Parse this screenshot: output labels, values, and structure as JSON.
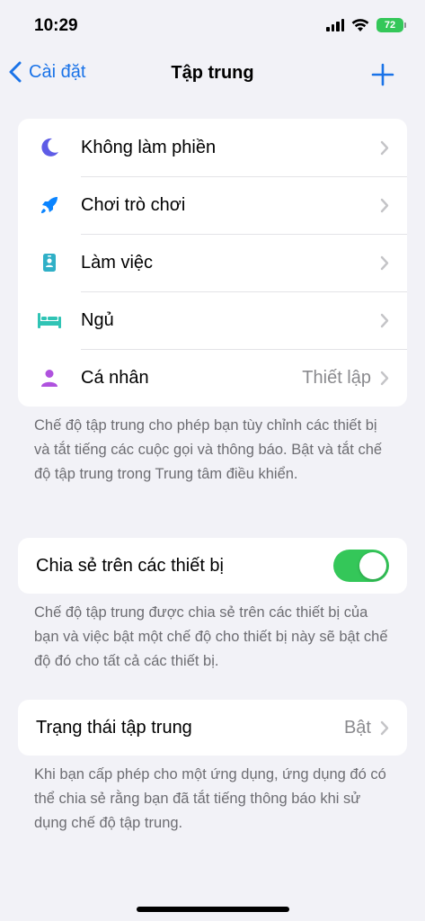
{
  "status_bar": {
    "time": "10:29",
    "battery": "72"
  },
  "nav": {
    "back_label": "Cài đặt",
    "title": "Tập trung"
  },
  "focus_modes": [
    {
      "label": "Không làm phiền",
      "icon": "moon-icon",
      "color": "#5e5ce6",
      "value": ""
    },
    {
      "label": "Chơi trò chơi",
      "icon": "rocket-icon",
      "color": "#0a84ff",
      "value": ""
    },
    {
      "label": "Làm việc",
      "icon": "id-badge-icon",
      "color": "#30b0c7",
      "value": ""
    },
    {
      "label": "Ngủ",
      "icon": "bed-icon",
      "color": "#30c4b5",
      "value": ""
    },
    {
      "label": "Cá nhân",
      "icon": "person-icon",
      "color": "#af52de",
      "value": "Thiết lập"
    }
  ],
  "focus_footnote": "Chế độ tập trung cho phép bạn tùy chỉnh các thiết bị và tắt tiếng các cuộc gọi và thông báo. Bật và tắt chế độ tập trung trong Trung tâm điều khiển.",
  "share": {
    "label": "Chia sẻ trên các thiết bị",
    "enabled": true,
    "footnote": "Chế độ tập trung được chia sẻ trên các thiết bị của bạn và việc bật một chế độ cho thiết bị này sẽ bật chế độ đó cho tất cả các thiết bị."
  },
  "focus_status": {
    "label": "Trạng thái tập trung",
    "value": "Bật",
    "footnote": "Khi bạn cấp phép cho một ứng dụng, ứng dụng đó có thể chia sẻ rằng bạn đã tắt tiếng thông báo khi sử dụng chế độ tập trung."
  },
  "colors": {
    "accent": "#1a73e8",
    "toggle_on": "#34c759",
    "background": "#f2f2f7"
  }
}
